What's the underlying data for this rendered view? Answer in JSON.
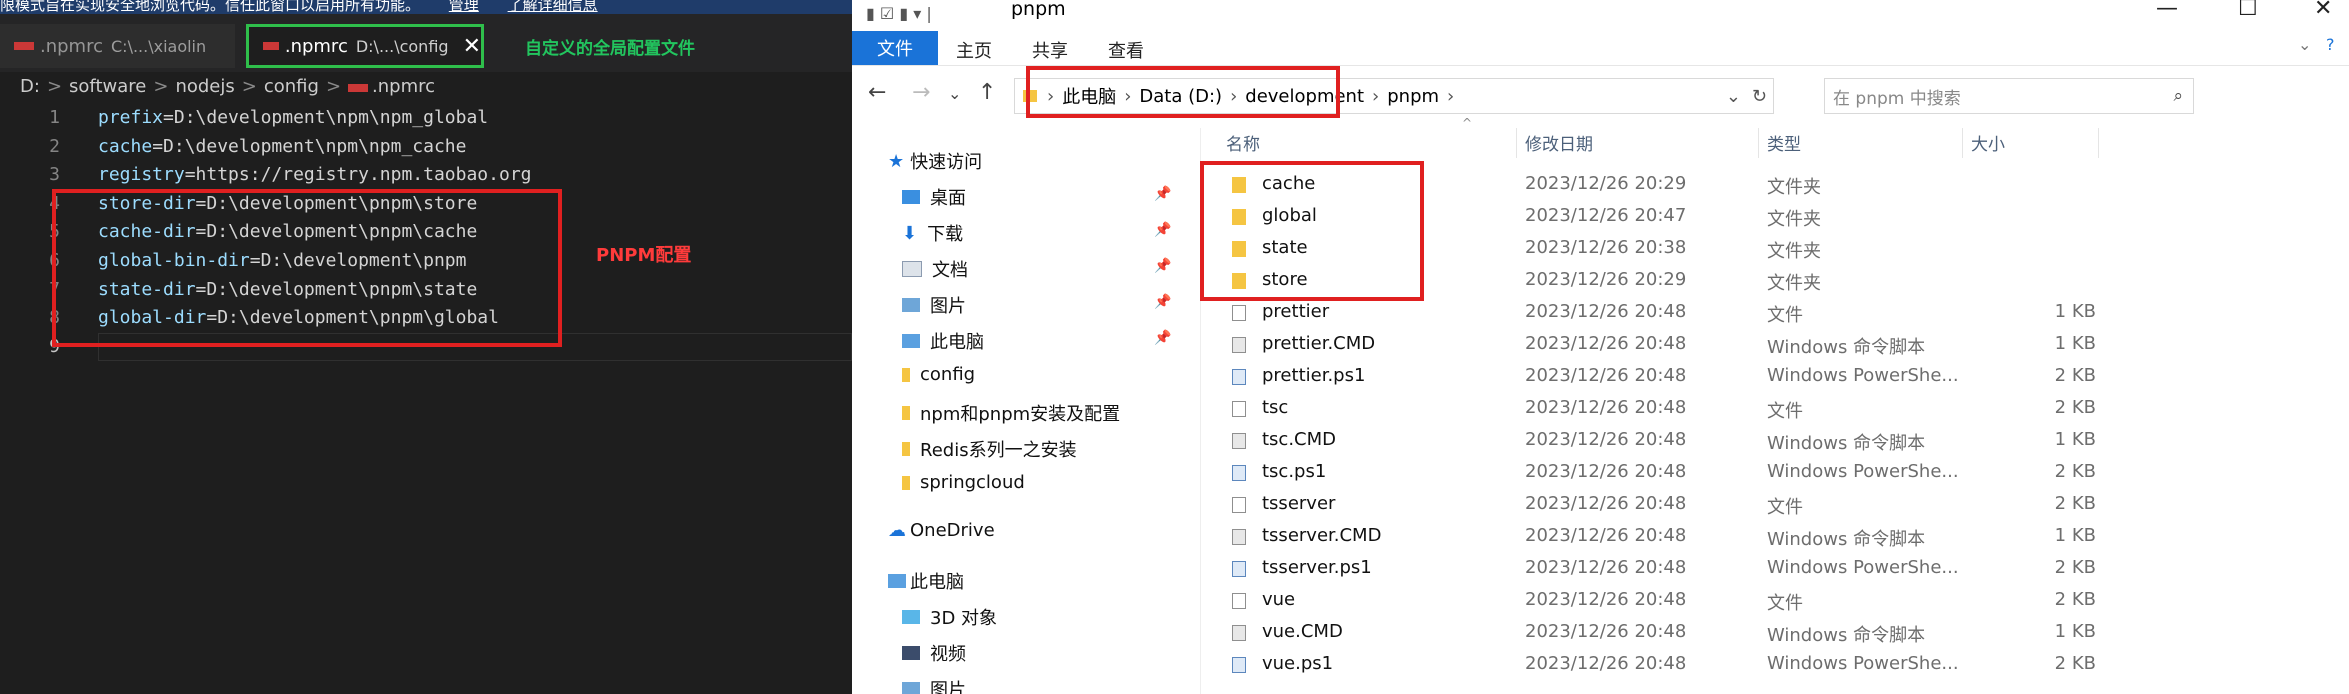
{
  "vscode": {
    "banner": [
      "限模式旨在实现安全地浏览代码。信任此窗口以启用所有功能。",
      "管理",
      "了解详细信息"
    ],
    "tabs": [
      {
        "name": ".npmrc",
        "path": "C:\\...\\xiaolin"
      },
      {
        "name": ".npmrc",
        "path": "D:\\...\\config",
        "close": "✕"
      }
    ],
    "tab_annotation": "自定义的全局配置文件",
    "breadcrumb": [
      "D:",
      "software",
      "nodejs",
      "config",
      ".npmrc"
    ],
    "lines": [
      {
        "n": "1",
        "key": "prefix",
        "val": "D:\\development\\npm\\npm_global"
      },
      {
        "n": "2",
        "key": "cache",
        "val": "D:\\development\\npm\\npm_cache"
      },
      {
        "n": "3",
        "key": "registry",
        "val": "https://registry.npm.taobao.org"
      },
      {
        "n": "4",
        "key": "store-dir",
        "val": "D:\\development\\pnpm\\store"
      },
      {
        "n": "5",
        "key": "cache-dir",
        "val": "D:\\development\\pnpm\\cache"
      },
      {
        "n": "6",
        "key": "global-bin-dir",
        "val": "D:\\development\\pnpm"
      },
      {
        "n": "7",
        "key": "state-dir",
        "val": "D:\\development\\pnpm\\state"
      },
      {
        "n": "8",
        "key": "global-dir",
        "val": "D:\\development\\pnpm\\global"
      },
      {
        "n": "9",
        "key": "",
        "val": ""
      }
    ],
    "pnpm_annotation": "PNPM配置"
  },
  "explorer": {
    "title": "pnpm",
    "controls": {
      "minimize": "—",
      "maximize": "☐",
      "close": "✕"
    },
    "ribbon_tabs": [
      "文件",
      "主页",
      "共享",
      "查看"
    ],
    "address": [
      "此电脑",
      "Data (D:)",
      "development",
      "pnpm"
    ],
    "search_placeholder": "在 pnpm 中搜索",
    "nav": [
      {
        "label": "快速访问",
        "icon": "star-icon",
        "pinned": false
      },
      {
        "label": "桌面",
        "icon": "desktop-icon",
        "pinned": true
      },
      {
        "label": "下载",
        "icon": "download-icon",
        "pinned": true
      },
      {
        "label": "文档",
        "icon": "document-icon",
        "pinned": true
      },
      {
        "label": "图片",
        "icon": "picture-icon",
        "pinned": true
      },
      {
        "label": "此电脑",
        "icon": "computer-icon",
        "pinned": true
      },
      {
        "label": "config",
        "icon": "folder-icon",
        "pinned": false
      },
      {
        "label": "npm和pnpm安装及配置",
        "icon": "folder-icon",
        "pinned": false
      },
      {
        "label": "Redis系列一之安装",
        "icon": "folder-icon",
        "pinned": false
      },
      {
        "label": "springcloud",
        "icon": "folder-icon",
        "pinned": false
      },
      {
        "label": "OneDrive",
        "icon": "cloud-icon",
        "pinned": false
      },
      {
        "label": "此电脑",
        "icon": "computer-icon",
        "pinned": false
      },
      {
        "label": "3D 对象",
        "icon": "cube-icon",
        "pinned": false
      },
      {
        "label": "视频",
        "icon": "video-icon",
        "pinned": false
      },
      {
        "label": "图片",
        "icon": "picture-icon",
        "pinned": false
      }
    ],
    "columns": [
      "名称",
      "修改日期",
      "类型",
      "大小"
    ],
    "files": [
      {
        "name": "cache",
        "date": "2023/12/26 20:29",
        "type": "文件夹",
        "size": "",
        "kind": "folder"
      },
      {
        "name": "global",
        "date": "2023/12/26 20:47",
        "type": "文件夹",
        "size": "",
        "kind": "folder"
      },
      {
        "name": "state",
        "date": "2023/12/26 20:38",
        "type": "文件夹",
        "size": "",
        "kind": "folder"
      },
      {
        "name": "store",
        "date": "2023/12/26 20:29",
        "type": "文件夹",
        "size": "",
        "kind": "folder"
      },
      {
        "name": "prettier",
        "date": "2023/12/26 20:48",
        "type": "文件",
        "size": "1 KB",
        "kind": "file"
      },
      {
        "name": "prettier.CMD",
        "date": "2023/12/26 20:48",
        "type": "Windows 命令脚本",
        "size": "1 KB",
        "kind": "cmd"
      },
      {
        "name": "prettier.ps1",
        "date": "2023/12/26 20:48",
        "type": "Windows PowerShe...",
        "size": "2 KB",
        "kind": "ps1"
      },
      {
        "name": "tsc",
        "date": "2023/12/26 20:48",
        "type": "文件",
        "size": "2 KB",
        "kind": "file"
      },
      {
        "name": "tsc.CMD",
        "date": "2023/12/26 20:48",
        "type": "Windows 命令脚本",
        "size": "1 KB",
        "kind": "cmd"
      },
      {
        "name": "tsc.ps1",
        "date": "2023/12/26 20:48",
        "type": "Windows PowerShe...",
        "size": "2 KB",
        "kind": "ps1"
      },
      {
        "name": "tsserver",
        "date": "2023/12/26 20:48",
        "type": "文件",
        "size": "2 KB",
        "kind": "file"
      },
      {
        "name": "tsserver.CMD",
        "date": "2023/12/26 20:48",
        "type": "Windows 命令脚本",
        "size": "1 KB",
        "kind": "cmd"
      },
      {
        "name": "tsserver.ps1",
        "date": "2023/12/26 20:48",
        "type": "Windows PowerShe...",
        "size": "2 KB",
        "kind": "ps1"
      },
      {
        "name": "vue",
        "date": "2023/12/26 20:48",
        "type": "文件",
        "size": "2 KB",
        "kind": "file"
      },
      {
        "name": "vue.CMD",
        "date": "2023/12/26 20:48",
        "type": "Windows 命令脚本",
        "size": "1 KB",
        "kind": "cmd"
      },
      {
        "name": "vue.ps1",
        "date": "2023/12/26 20:48",
        "type": "Windows PowerShe...",
        "size": "2 KB",
        "kind": "ps1"
      }
    ]
  }
}
